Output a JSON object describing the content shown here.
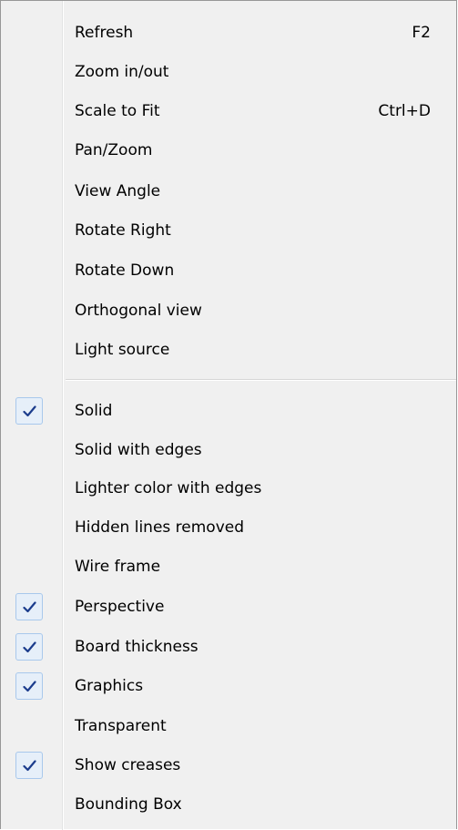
{
  "menu": {
    "items": [
      {
        "label": "Refresh",
        "shortcut": "F2",
        "checked": false
      },
      {
        "label": "Zoom in/out",
        "shortcut": "",
        "checked": false
      },
      {
        "label": "Scale to Fit",
        "shortcut": "Ctrl+D",
        "checked": false
      },
      {
        "label": "Pan/Zoom",
        "shortcut": "",
        "checked": false
      },
      {
        "label": "View Angle",
        "shortcut": "",
        "checked": false
      },
      {
        "label": "Rotate Right",
        "shortcut": "",
        "checked": false
      },
      {
        "label": "Rotate Down",
        "shortcut": "",
        "checked": false
      },
      {
        "label": "Orthogonal view",
        "shortcut": "",
        "checked": false
      },
      {
        "label": "Light source",
        "shortcut": "",
        "checked": false
      },
      {
        "label": "Solid",
        "shortcut": "",
        "checked": true
      },
      {
        "label": "Solid with edges",
        "shortcut": "",
        "checked": false
      },
      {
        "label": "Lighter color with edges",
        "shortcut": "",
        "checked": false
      },
      {
        "label": "Hidden lines removed",
        "shortcut": "",
        "checked": false
      },
      {
        "label": "Wire frame",
        "shortcut": "",
        "checked": false
      },
      {
        "label": "Perspective",
        "shortcut": "",
        "checked": true
      },
      {
        "label": "Board thickness",
        "shortcut": "",
        "checked": true
      },
      {
        "label": "Graphics",
        "shortcut": "",
        "checked": true
      },
      {
        "label": "Transparent",
        "shortcut": "",
        "checked": false
      },
      {
        "label": "Show creases",
        "shortcut": "",
        "checked": true
      },
      {
        "label": "Bounding Box",
        "shortcut": "",
        "checked": false
      }
    ]
  },
  "icons": {
    "check": "checkmark-icon"
  },
  "colors": {
    "menu_background": "#f0f0f0",
    "check_highlight": "#e6eff9",
    "check_border": "#a8c8ec",
    "check_mark": "#1b3c8c"
  }
}
